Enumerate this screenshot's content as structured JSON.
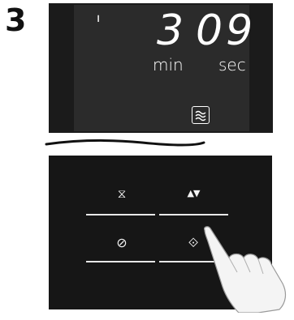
{
  "step_number": "3",
  "display": {
    "digit_hour": "'",
    "digit_min": "3",
    "digit_sec": "09",
    "unit_min": "min",
    "unit_sec": "sec",
    "mode_icon": "microwave-waves-icon"
  },
  "panel": {
    "keys": [
      {
        "name": "timer",
        "glyph": "⧖",
        "icon": "hourglass-icon"
      },
      {
        "name": "up-down",
        "glyph": "▲▼",
        "icon": "up-down-arrows-icon"
      },
      {
        "name": "stop",
        "glyph": "⊘",
        "icon": "stop-cancel-icon"
      },
      {
        "name": "start",
        "glyph": "⟐",
        "icon": "start-icon"
      }
    ]
  },
  "colors": {
    "display_bg": "#1b1b1b",
    "lcd_bg": "#2b2b2b",
    "panel_bg": "#161616",
    "lcd_text": "#ffffff"
  }
}
